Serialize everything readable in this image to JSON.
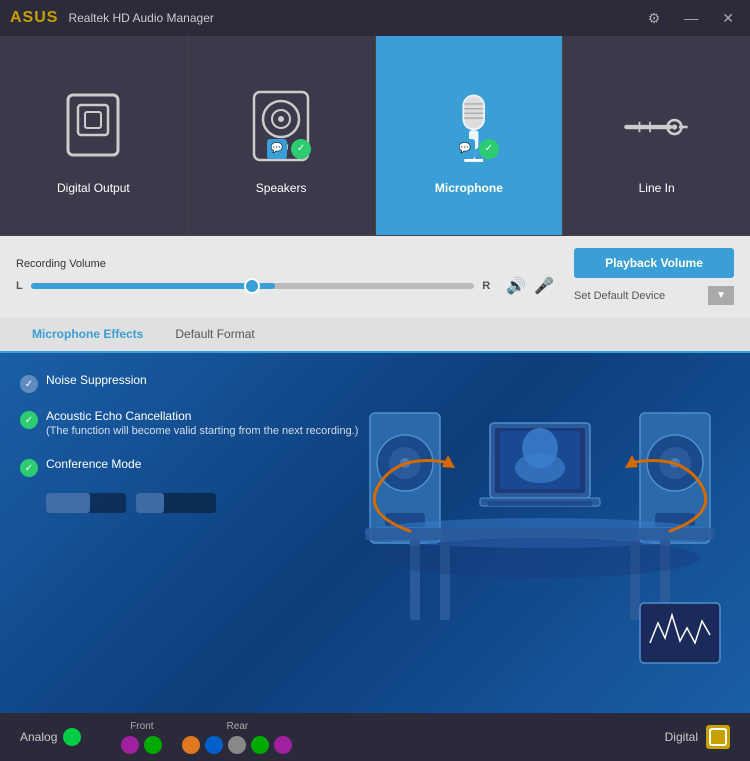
{
  "titlebar": {
    "logo": "ASUS",
    "title": "Realtek HD Audio Manager",
    "settings_icon": "⚙",
    "minimize_icon": "—",
    "close_icon": "✕"
  },
  "device_tabs": [
    {
      "id": "digital-output",
      "label": "Digital Output",
      "active": false,
      "has_badge": false
    },
    {
      "id": "speakers",
      "label": "Speakers",
      "active": false,
      "has_badge": true
    },
    {
      "id": "microphone",
      "label": "Microphone",
      "active": true,
      "has_badge": true
    },
    {
      "id": "line-in",
      "label": "Line In",
      "active": false,
      "has_badge": false
    }
  ],
  "controls": {
    "volume_label": "Recording Volume",
    "slider_left": "L",
    "slider_right": "R",
    "playback_button": "Playback Volume",
    "default_device": "Set Default Device"
  },
  "tabs": [
    {
      "id": "microphone-effects",
      "label": "Microphone Effects",
      "active": true
    },
    {
      "id": "default-format",
      "label": "Default Format",
      "active": false
    }
  ],
  "effects": [
    {
      "id": "noise-suppression",
      "label": "Noise Suppression",
      "active": false,
      "subtext": ""
    },
    {
      "id": "acoustic-echo",
      "label": "Acoustic Echo Cancellation",
      "active": true,
      "subtext": "(The function will become valid starting from the next recording.)"
    },
    {
      "id": "conference-mode",
      "label": "Conference Mode",
      "active": true,
      "subtext": ""
    }
  ],
  "status_bar": {
    "analog_label": "Analog",
    "front_label": "Front",
    "rear_label": "Rear",
    "digital_label": "Digital",
    "front_dots": [
      "#a020a0",
      "#00aa00"
    ],
    "rear_dots": [
      "#e07820",
      "#0060cc",
      "#808080",
      "#00aa00",
      "#a020a0"
    ],
    "digital_icon": "🔲"
  }
}
